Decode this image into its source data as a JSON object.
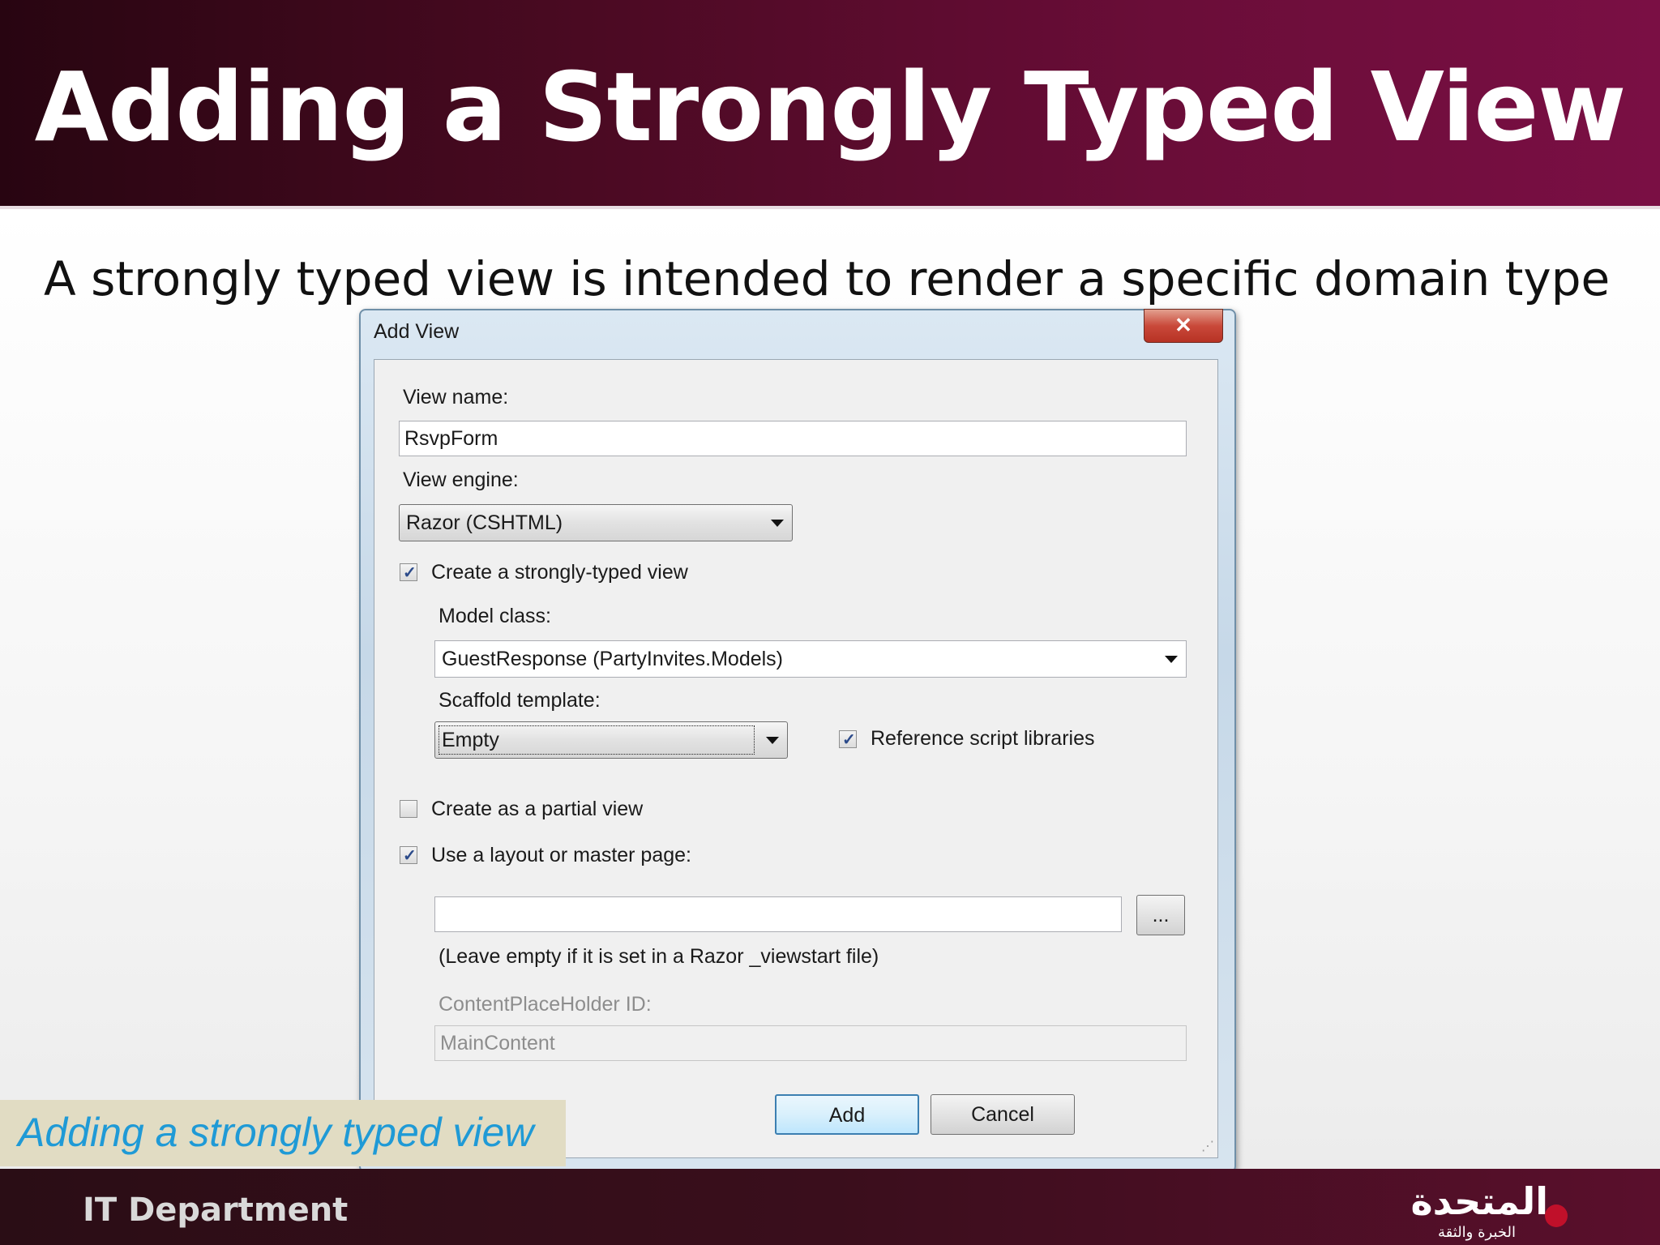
{
  "slide": {
    "title": "Adding a Strongly Typed View",
    "subtitle": "A strongly typed view is intended to render a specific domain type",
    "caption": "Adding a strongly typed view",
    "footer": "IT Department",
    "logo": {
      "text_main": "المتحدة",
      "text_sub": "الخبرة والثقة"
    }
  },
  "dialog": {
    "title": "Add View",
    "close_icon": "close-icon",
    "view_name_label": "View name:",
    "view_name_value": "RsvpForm",
    "view_engine_label": "View engine:",
    "view_engine_value": "Razor (CSHTML)",
    "strongly_typed_label": "Create a strongly-typed view",
    "strongly_typed_checked": true,
    "model_class_label": "Model class:",
    "model_class_value": "GuestResponse (PartyInvites.Models)",
    "scaffold_label": "Scaffold template:",
    "scaffold_value": "Empty",
    "reference_scripts_label": "Reference script libraries",
    "reference_scripts_checked": true,
    "partial_view_label": "Create as a partial view",
    "partial_view_checked": false,
    "layout_label": "Use a layout or master page:",
    "layout_checked": true,
    "layout_value": "",
    "browse_label": "...",
    "layout_hint": "(Leave empty if it is set in a Razor _viewstart file)",
    "placeholder_id_label": "ContentPlaceHolder ID:",
    "placeholder_id_value": "MainContent",
    "add_label": "Add",
    "cancel_label": "Cancel"
  }
}
